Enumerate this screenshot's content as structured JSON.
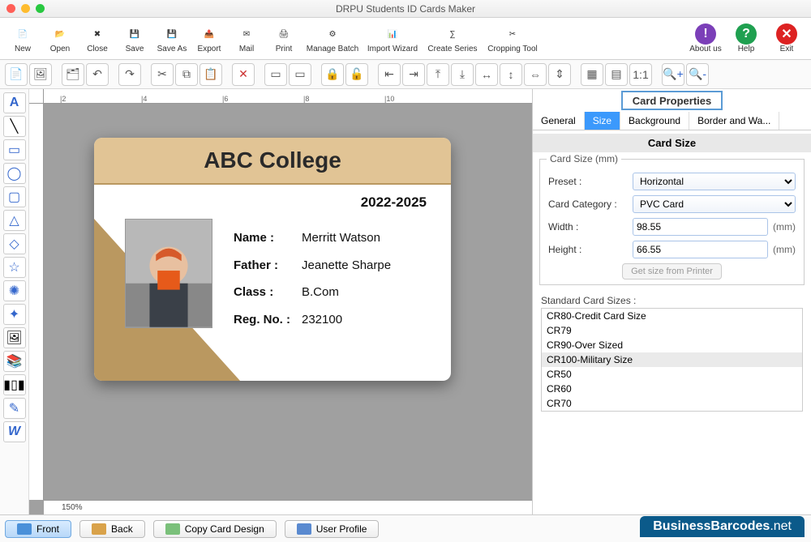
{
  "window": {
    "title": "DRPU Students ID Cards Maker"
  },
  "mainToolbar": [
    {
      "label": "New"
    },
    {
      "label": "Open"
    },
    {
      "label": "Close"
    },
    {
      "label": "Save"
    },
    {
      "label": "Save As"
    },
    {
      "label": "Export"
    },
    {
      "label": "Mail"
    },
    {
      "label": "Print"
    },
    {
      "label": "Manage Batch",
      "wide": true
    },
    {
      "label": "Import Wizard",
      "wide": true
    },
    {
      "label": "Create Series",
      "wide": true
    },
    {
      "label": "Cropping Tool",
      "wide": true
    }
  ],
  "rightToolbar": [
    {
      "label": "About us",
      "color": "#7b3fb8",
      "glyph": "!"
    },
    {
      "label": "Help",
      "color": "#1fa050",
      "glyph": "?"
    },
    {
      "label": "Exit",
      "color": "#d22",
      "glyph": "✕"
    }
  ],
  "ruler": {
    "marks": [
      "|2",
      "|4",
      "|6",
      "|8",
      "|10"
    ]
  },
  "zoom": "150%",
  "card": {
    "title": "ABC College",
    "batch": "2022-2025",
    "fields": [
      {
        "k": "Name :",
        "v": "Merritt Watson"
      },
      {
        "k": "Father :",
        "v": "Jeanette Sharpe"
      },
      {
        "k": "Class :",
        "v": "B.Com"
      },
      {
        "k": "Reg. No. :",
        "v": "232100"
      }
    ]
  },
  "props": {
    "title": "Card Properties",
    "tabs": [
      "General",
      "Size",
      "Background",
      "Border and Wa..."
    ],
    "activeTab": 1,
    "sectionTitle": "Card Size",
    "groupTitle": "Card Size (mm)",
    "presetLabel": "Preset :",
    "preset": "Horizontal",
    "categoryLabel": "Card Category :",
    "category": "PVC Card",
    "widthLabel": "Width :",
    "width": "98.55",
    "heightLabel": "Height :",
    "height": "66.55",
    "unit": "(mm)",
    "printerBtn": "Get size from Printer",
    "stdLabel": "Standard Card Sizes :",
    "stdSizes": [
      "CR80-Credit Card Size",
      "CR79",
      "CR90-Over Sized",
      "CR100-Military Size",
      "CR50",
      "CR60",
      "CR70"
    ],
    "stdSelected": 3
  },
  "bottom": {
    "front": "Front",
    "back": "Back",
    "copy": "Copy Card Design",
    "profile": "User Profile"
  },
  "watermark": {
    "brand": "BusinessBarcodes",
    "tld": ".net"
  }
}
